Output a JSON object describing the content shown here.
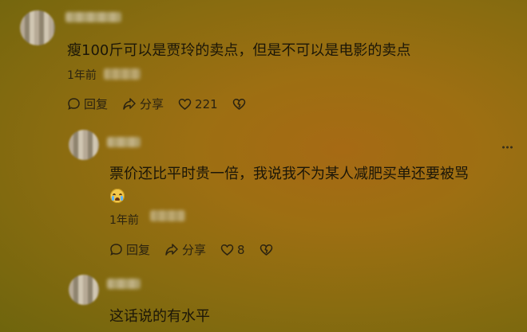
{
  "comments": [
    {
      "text": "瘦100斤可以是贾玲的卖点，但是不可以是电影的卖点",
      "time": "1年前",
      "reply_label": "回复",
      "share_label": "分享",
      "likes": "221"
    },
    {
      "text": "票价还比平时贵一倍，我说我不为某人减肥买单还要被骂",
      "emoji": "crying-face",
      "time": "1年前",
      "reply_label": "回复",
      "share_label": "分享",
      "likes": "8"
    },
    {
      "text": "这话说的有水平"
    }
  ],
  "colors": {
    "background": "#9d6f12",
    "text": "#1b1608"
  },
  "icons": [
    "comment-icon",
    "share-icon",
    "heart-icon",
    "dislike-icon",
    "more-icon"
  ]
}
